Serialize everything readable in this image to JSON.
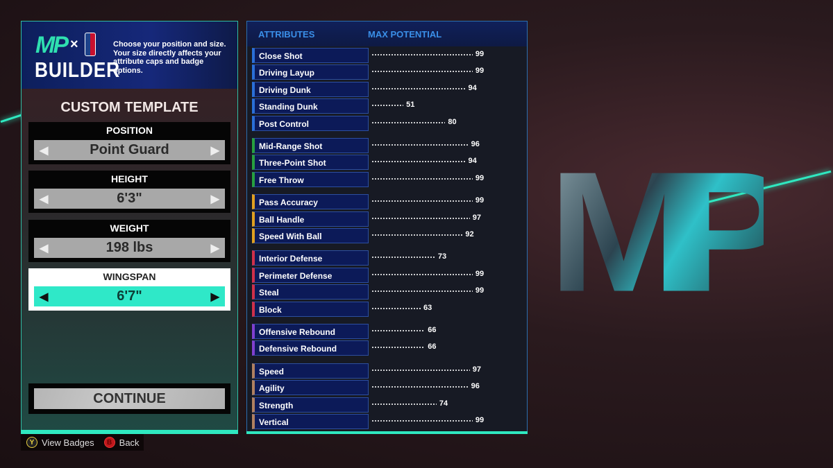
{
  "header": {
    "logo": "MP x NBA BUILDER",
    "builder": "BUILDER",
    "x": "×",
    "description": "Choose your position and size. Your size directly affects your attribute caps and badge options."
  },
  "template_title": "CUSTOM TEMPLATE",
  "selectors": [
    {
      "label": "POSITION",
      "value": "Point Guard"
    },
    {
      "label": "HEIGHT",
      "value": "6'3\""
    },
    {
      "label": "WEIGHT",
      "value": "198 lbs"
    },
    {
      "label": "WINGSPAN",
      "value": "6'7\"",
      "active": true
    }
  ],
  "continue_label": "CONTINUE",
  "hints": {
    "y_label": "View Badges",
    "y_key": "Y",
    "b_label": "Back",
    "b_key": "B"
  },
  "table": {
    "col1": "ATTRIBUTES",
    "col2": "MAX POTENTIAL"
  },
  "groups": [
    {
      "color": "#2a6fd8",
      "items": [
        [
          "Close Shot",
          99
        ],
        [
          "Driving Layup",
          99
        ],
        [
          "Driving Dunk",
          94
        ],
        [
          "Standing Dunk",
          51
        ],
        [
          "Post Control",
          80
        ]
      ]
    },
    {
      "color": "#27a040",
      "items": [
        [
          "Mid-Range Shot",
          96
        ],
        [
          "Three-Point Shot",
          94
        ],
        [
          "Free Throw",
          99
        ]
      ]
    },
    {
      "color": "#e0a020",
      "items": [
        [
          "Pass Accuracy",
          99
        ],
        [
          "Ball Handle",
          97
        ],
        [
          "Speed With Ball",
          92
        ]
      ]
    },
    {
      "color": "#d0304a",
      "items": [
        [
          "Interior Defense",
          73
        ],
        [
          "Perimeter Defense",
          99
        ],
        [
          "Steal",
          99
        ],
        [
          "Block",
          63
        ]
      ]
    },
    {
      "color": "#8040d0",
      "items": [
        [
          "Offensive Rebound",
          66
        ],
        [
          "Defensive Rebound",
          66
        ]
      ]
    },
    {
      "color": "#b08060",
      "items": [
        [
          "Speed",
          97
        ],
        [
          "Agility",
          96
        ],
        [
          "Strength",
          74
        ],
        [
          "Vertical",
          99
        ]
      ]
    }
  ],
  "colors": {
    "accent": "#2fe8c0",
    "panel_blue": "#0c1a58"
  }
}
